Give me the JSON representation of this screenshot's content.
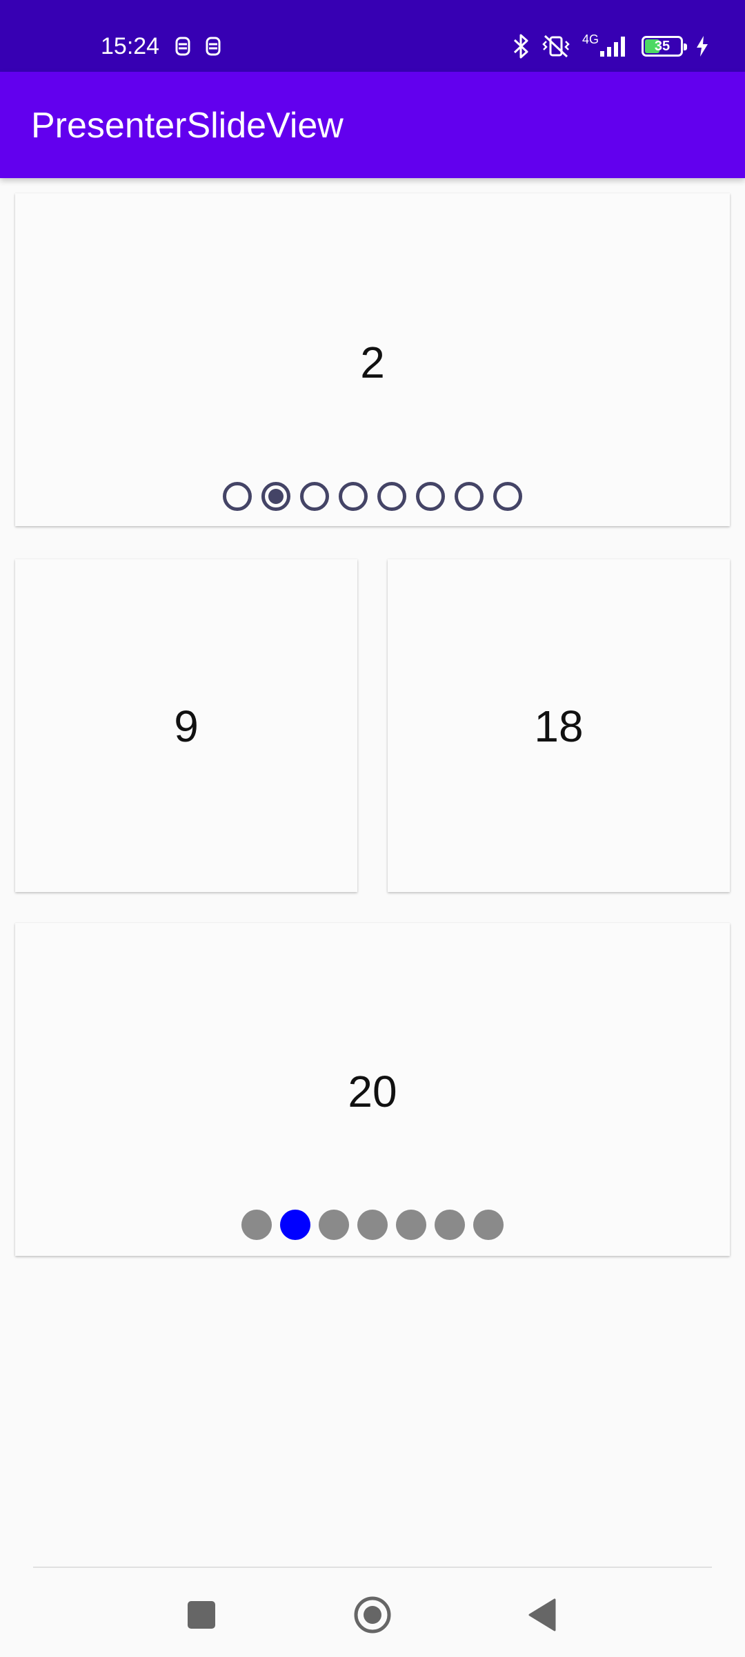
{
  "status_bar": {
    "time": "15:24",
    "network_label": "4G",
    "battery_level": "35",
    "icons": [
      "notification-icon",
      "notification-icon",
      "bluetooth-icon",
      "vibrate-off-icon",
      "signal-icon",
      "battery-icon",
      "charging-icon"
    ]
  },
  "app_bar": {
    "title": "PresenterSlideView"
  },
  "cards": [
    {
      "number": "2",
      "indicator_style": "ring",
      "indicator_count": 8,
      "active_index": 1,
      "indicator_color": "#444466"
    },
    {
      "number": "9"
    },
    {
      "number": "18"
    },
    {
      "number": "20",
      "indicator_style": "dot",
      "indicator_count": 7,
      "active_index": 1,
      "indicator_color": "#8a8a8a",
      "active_color": "#0000ff"
    }
  ],
  "nav_bar": {
    "buttons": [
      "recent-apps",
      "home",
      "back"
    ]
  },
  "colors": {
    "status_bar": "#3700b3",
    "app_bar": "#6200ee",
    "background": "#fafafa"
  }
}
